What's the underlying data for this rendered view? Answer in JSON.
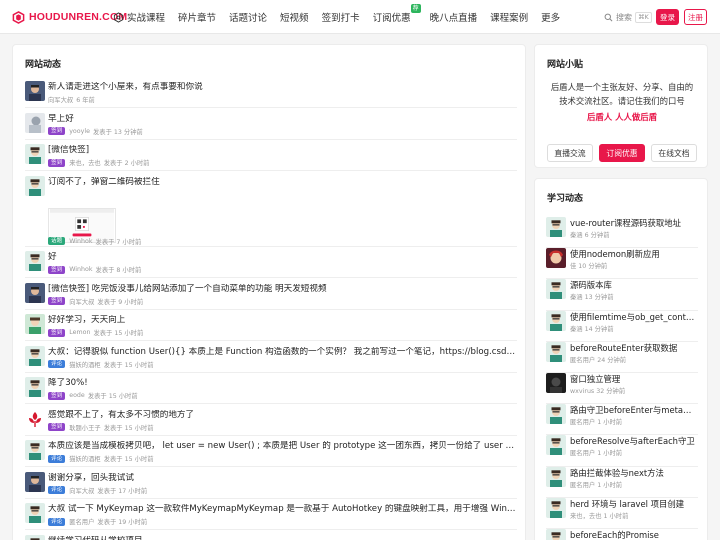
{
  "header": {
    "logo_text": "HOUDUNREN.COM",
    "nav": [
      {
        "label": "实战课程",
        "icon": "course-icon"
      },
      {
        "label": "碎片章节"
      },
      {
        "label": "话题讨论"
      },
      {
        "label": "短视频"
      },
      {
        "label": "签到打卡"
      },
      {
        "label": "订阅优惠",
        "badge": "荐"
      },
      {
        "label": "晚八点直播"
      },
      {
        "label": "课程案例"
      },
      {
        "label": "更多"
      }
    ],
    "search_label": "搜索",
    "search_shortcut": "⌘K",
    "login_label": "登录",
    "register_label": "注册"
  },
  "feed": {
    "title": "网站动态",
    "items": [
      {
        "text": "新人请走进这个小屋来，有点事要和你说",
        "tag": "",
        "author": "向军大叔",
        "time": "6 年前",
        "avatar": "portrait"
      },
      {
        "text": "早上好",
        "tag": "签到",
        "author": "yooyle",
        "time": "发表于 13 分钟前",
        "avatar": "grey"
      },
      {
        "text": "[微信快签]",
        "tag": "签到",
        "author": "来也，去也",
        "time": "发表于 2 小时前",
        "avatar": "teal"
      },
      {
        "text": "订阅不了，弹窗二维码被拦住",
        "tag": "话题",
        "author": "Winhok",
        "time": "发表于 7 小时前",
        "avatar": "teal",
        "has_image": true
      },
      {
        "text": "好",
        "tag": "签到",
        "author": "Winhok",
        "time": "发表于 8 小时前",
        "avatar": "teal"
      },
      {
        "text": "[微信快签] 吃完饭没事儿给网站添加了一个自动菜单的功能 明天发短视频",
        "tag": "签到",
        "author": "向军大叔",
        "time": "发表于 9 小时前",
        "avatar": "portrait"
      },
      {
        "text": "好好学习，天天向上",
        "tag": "签到",
        "author": "Lemon",
        "time": "发表于 15 小时前",
        "avatar": "green"
      },
      {
        "text": "大叔：记得貌似 function User(){} 本质上是 Function 构造函数的一个实例？ 我之前写过一个笔记，https://blog.csdn.net/weixin_43372836/article/details/...",
        "tag": "评论",
        "author": "猫妖的酒柜",
        "time": "发表于 15 小时前",
        "avatar": "teal"
      },
      {
        "text": "降了30%!",
        "tag": "签到",
        "author": "eode",
        "time": "发表于 15 小时前",
        "avatar": "teal"
      },
      {
        "text": "感觉跟不上了，有太多不习惯的地方了",
        "tag": "签到",
        "author": "耿题小王子",
        "time": "发表于 15 小时前",
        "avatar": "flower"
      },
      {
        "text": "本质应该是当成模板拷贝吧，  let user = new User() ; 本质是把 User 的 prototype 这一团东西，拷贝一份给了 user 的 __proto__ 上",
        "tag": "评论",
        "author": "猫妖的酒柜",
        "time": "发表于 15 小时前",
        "avatar": "teal"
      },
      {
        "text": "谢谢分享，回头我试试",
        "tag": "评论",
        "author": "向军大叔",
        "time": "发表于 17 小时前",
        "avatar": "portrait"
      },
      {
        "text": "大叔 试一下 MyKeymap 这一款软件MyKeymapMyKeymap 是一款基于 AutoHotkey 的键盘映射工具，用于增强 Windows 的键盘输入体验",
        "tag": "评论",
        "author": "匿名用户",
        "time": "发表于 19 小时前",
        "avatar": "teal"
      },
      {
        "text": "继续学习代码从学校项目",
        "tag": "签到",
        "author": "",
        "time": "",
        "avatar": "teal"
      }
    ]
  },
  "sidebar": {
    "title": "网站小贴",
    "desc": "后盾人是一个主张友好、分享、自由的技术交流社区。请记住我们的口号",
    "slogan": "后盾人 人人做后盾",
    "buttons": [
      "直播交流",
      "订阅优惠",
      "在线文档"
    ]
  },
  "learn": {
    "title": "学习动态",
    "items": [
      {
        "title": "vue-router课程源码获取地址",
        "meta": "秦涵   6 分钟前",
        "avatar": "teal"
      },
      {
        "title": "使用nodemon刷新应用",
        "meta": "佳   10 分钟前",
        "avatar": "anime"
      },
      {
        "title": "源码版本库",
        "meta": "秦涵   13 分钟前",
        "avatar": "teal"
      },
      {
        "title": "使用filemtime与ob_get_contents缓存",
        "meta": "秦涵   14 分钟前",
        "avatar": "teal"
      },
      {
        "title": "beforeRouteEnter获取数据",
        "meta": "匿名用户   24 分钟前",
        "avatar": "teal"
      },
      {
        "title": "窗口独立管理",
        "meta": "wxvirus   32 分钟前",
        "avatar": "dark"
      },
      {
        "title": "路由守卫beforeEnter与meta元数据",
        "meta": "匿名用户   1 小时前",
        "avatar": "teal"
      },
      {
        "title": "beforeResolve与afterEach守卫",
        "meta": "匿名用户   1 小时前",
        "avatar": "teal"
      },
      {
        "title": "路由拦截体验与next方法",
        "meta": "匿名用户   1 小时前",
        "avatar": "teal"
      },
      {
        "title": "herd 环境与 laravel 项目创建",
        "meta": "来也，去也   1 小时前",
        "avatar": "teal"
      },
      {
        "title": "beforeEach的Promise",
        "meta": "",
        "avatar": "teal"
      }
    ]
  }
}
